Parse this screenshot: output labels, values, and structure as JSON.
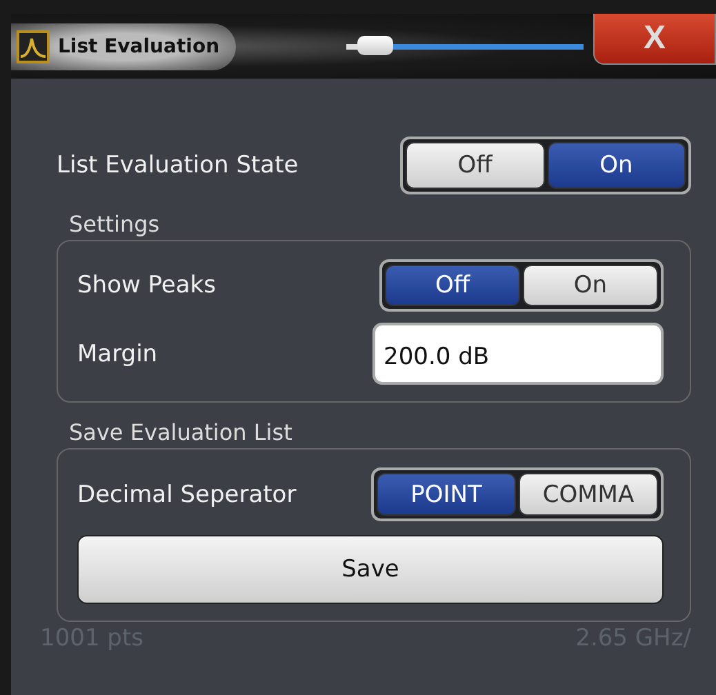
{
  "window": {
    "title": "List Evaluation",
    "close": "X",
    "transparency": {
      "level": 0.12
    }
  },
  "state": {
    "label": "List Evaluation State",
    "options": [
      {
        "label": "Off",
        "selected": false
      },
      {
        "label": "On",
        "selected": true
      }
    ]
  },
  "settings": {
    "title": "Settings",
    "show_peaks": {
      "label": "Show Peaks",
      "options": [
        {
          "label": "Off",
          "selected": true
        },
        {
          "label": "On",
          "selected": false
        }
      ]
    },
    "margin": {
      "label": "Margin",
      "value": "200.0 dB"
    }
  },
  "save_list": {
    "title": "Save Evaluation List",
    "separator": {
      "label": "Decimal Seperator",
      "options": [
        {
          "label": "POINT",
          "selected": true
        },
        {
          "label": "COMMA",
          "selected": false
        }
      ]
    },
    "save_button": "Save"
  },
  "footer": {
    "points": "1001 pts",
    "span": "2.65 GHz/"
  }
}
